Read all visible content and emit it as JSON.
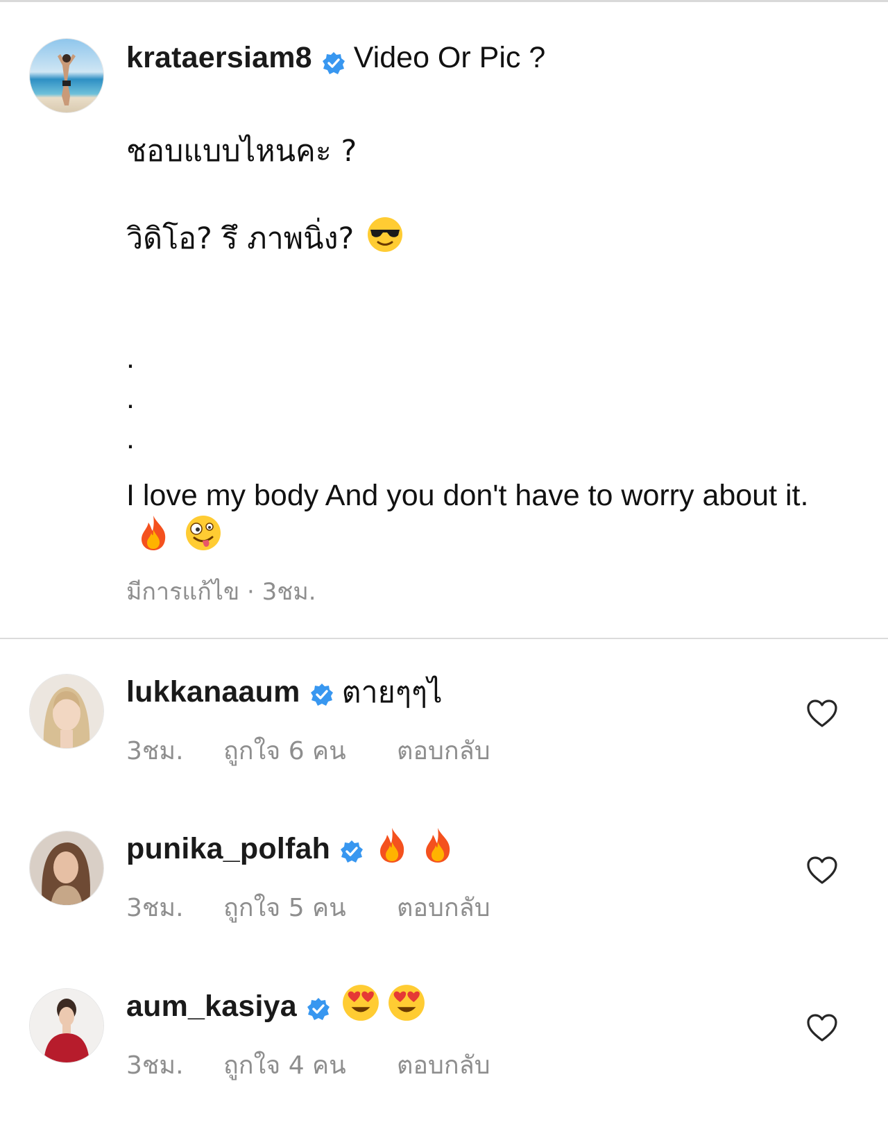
{
  "caption": {
    "username": "krataersiam8",
    "title_text": "Video Or  Pic ?",
    "thai_question": "ชอบแบบไหนคะ ?",
    "thai_question2": "วิดิโอ? รึ ภาพนิ่ง?",
    "dots": [
      ".",
      ".",
      "."
    ],
    "body_text": "I love my body And you don't have to worry about it.",
    "meta": "มีการแก้ไข · 3ชม."
  },
  "comments": [
    {
      "username": "lukkanaaum",
      "text": "ตายๆๆไ",
      "emojis": [],
      "time": "3ชม.",
      "likes": "ถูกใจ 6 คน",
      "reply": "ตอบกลับ"
    },
    {
      "username": "punika_polfah",
      "text": "",
      "emojis": [
        "fire-emoji",
        "fire-emoji"
      ],
      "time": "3ชม.",
      "likes": "ถูกใจ 5 คน",
      "reply": "ตอบกลับ"
    },
    {
      "username": "aum_kasiya",
      "text": "",
      "emojis": [
        "heart-eyes-emoji",
        "heart-eyes-emoji"
      ],
      "time": "3ชม.",
      "likes": "ถูกใจ 4 คน",
      "reply": "ตอบกลับ"
    }
  ],
  "colors": {
    "verified_blue": "#3897f0",
    "meta_gray": "#8e8e8e",
    "divider": "#dbdbdb"
  }
}
